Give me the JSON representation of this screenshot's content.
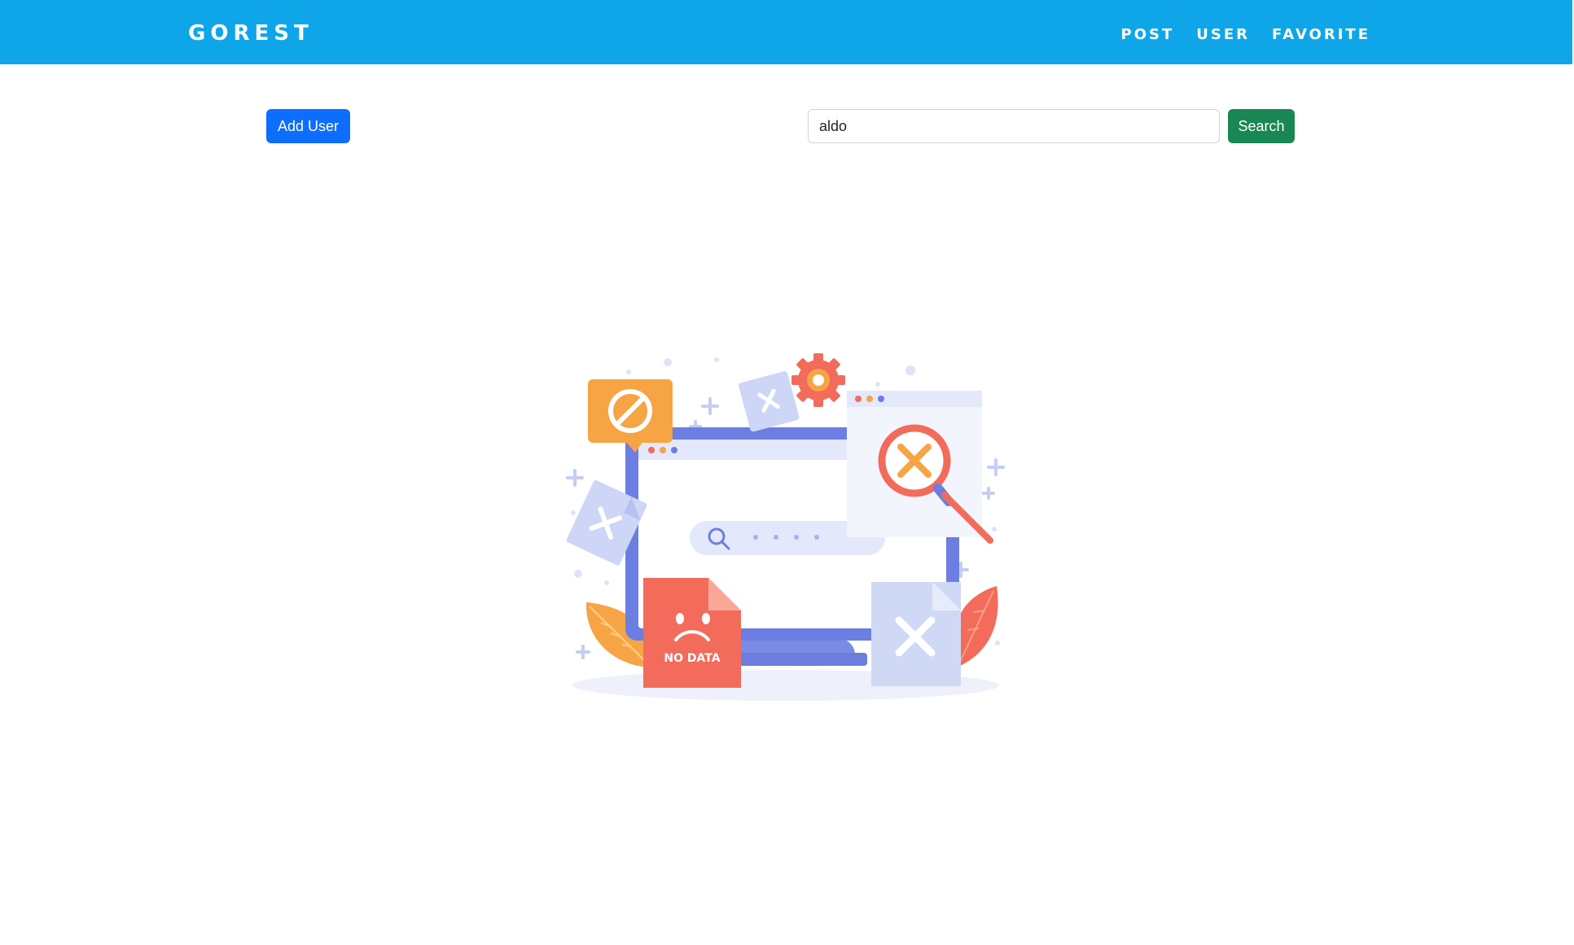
{
  "navbar": {
    "brand": "GOREST",
    "links": [
      "POST",
      "USER",
      "FAVORITE"
    ]
  },
  "toolbar": {
    "add_user_label": "Add User",
    "search_value": "aldo",
    "search_label": "Search"
  },
  "empty_state": {
    "image_text": "NO DATA"
  },
  "colors": {
    "navbar": "#0fa6e9",
    "add_button": "#0d6efd",
    "search_button": "#198754"
  }
}
